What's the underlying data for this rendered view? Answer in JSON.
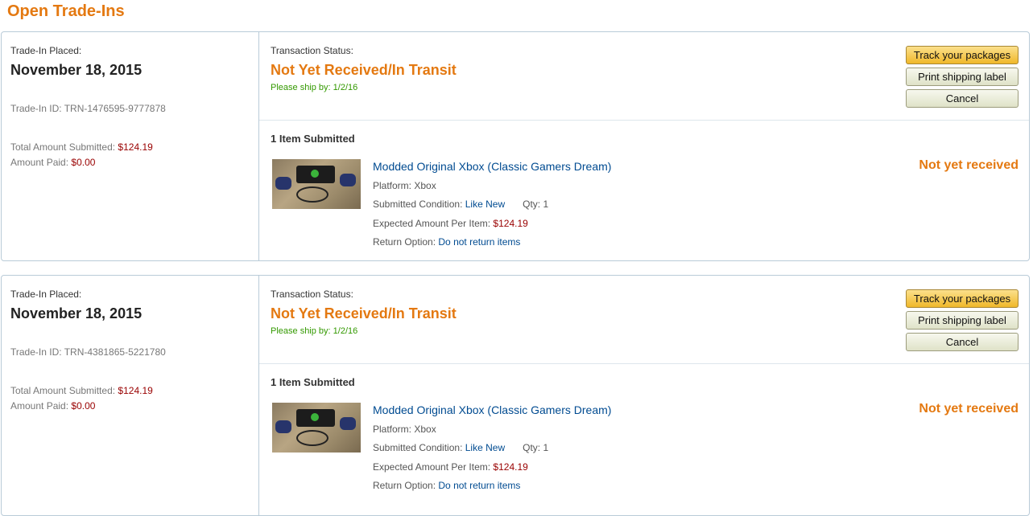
{
  "page": {
    "title": "Open Trade-Ins"
  },
  "tradeins": [
    {
      "placed_label": "Trade-In Placed:",
      "placed_date": "November 18, 2015",
      "id_label": "Trade-In ID:",
      "id": "TRN-1476595-9777878",
      "total_label": "Total Amount Submitted:",
      "total": "$124.19",
      "paid_label": "Amount Paid:",
      "paid": "$0.00",
      "status_label": "Transaction Status:",
      "status": "Not Yet Received/In Transit",
      "ship_by": "Please ship by: 1/2/16",
      "buttons": {
        "track": "Track your packages",
        "print": "Print shipping label",
        "cancel": "Cancel"
      },
      "items_count": "1 Item Submitted",
      "item": {
        "name": "Modded Original Xbox (Classic Gamers Dream)",
        "platform_label": "Platform:",
        "platform": "Xbox",
        "condition_label": "Submitted Condition:",
        "condition": "Like New",
        "qty_label": "Qty:",
        "qty": "1",
        "expected_label": "Expected Amount Per Item:",
        "expected": "$124.19",
        "return_label": "Return Option:",
        "return_option": "Do not return items",
        "status": "Not yet received"
      }
    },
    {
      "placed_label": "Trade-In Placed:",
      "placed_date": "November 18, 2015",
      "id_label": "Trade-In ID:",
      "id": "TRN-4381865-5221780",
      "total_label": "Total Amount Submitted:",
      "total": "$124.19",
      "paid_label": "Amount Paid:",
      "paid": "$0.00",
      "status_label": "Transaction Status:",
      "status": "Not Yet Received/In Transit",
      "ship_by": "Please ship by: 1/2/16",
      "buttons": {
        "track": "Track your packages",
        "print": "Print shipping label",
        "cancel": "Cancel"
      },
      "items_count": "1 Item Submitted",
      "item": {
        "name": "Modded Original Xbox (Classic Gamers Dream)",
        "platform_label": "Platform:",
        "platform": "Xbox",
        "condition_label": "Submitted Condition:",
        "condition": "Like New",
        "qty_label": "Qty:",
        "qty": "1",
        "expected_label": "Expected Amount Per Item:",
        "expected": "$124.19",
        "return_label": "Return Option:",
        "return_option": "Do not return items",
        "status": "Not yet received"
      }
    }
  ],
  "colors": {
    "accent": "#e47911",
    "link": "#004b91",
    "price": "#990000",
    "ship_by": "#339900",
    "border": "#b9cbd8"
  }
}
